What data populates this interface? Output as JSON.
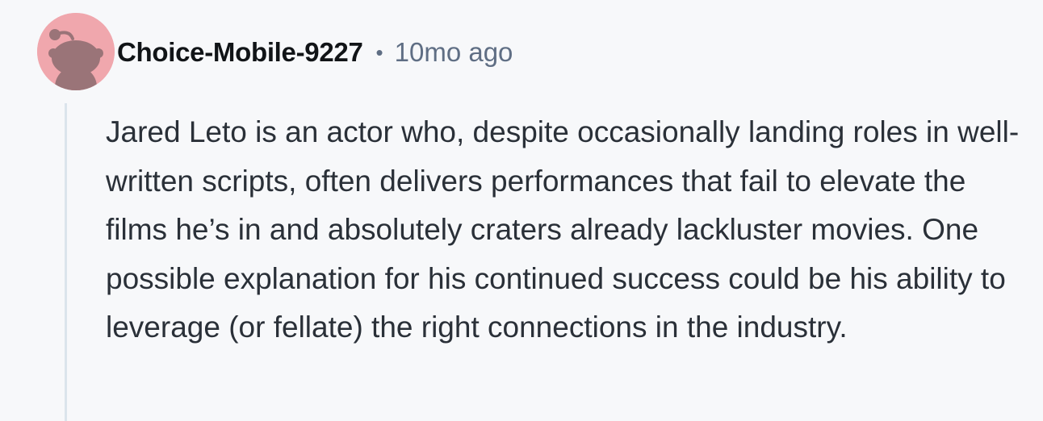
{
  "comment": {
    "avatar_icon": "reddit-snoo-avatar-icon",
    "avatar_color": "#f0a7ad",
    "username": "Choice-Mobile-9227",
    "separator": "•",
    "timestamp": "10mo ago",
    "body": "Jared Leto is an actor who, despite occasionally landing roles in well-written scripts, often delivers performances that fail to elevate the films he’s in and absolutely craters already lackluster movies. One possible explanation for his continued success could be his ability to leverage (or fellate) the right connections in the industry."
  }
}
